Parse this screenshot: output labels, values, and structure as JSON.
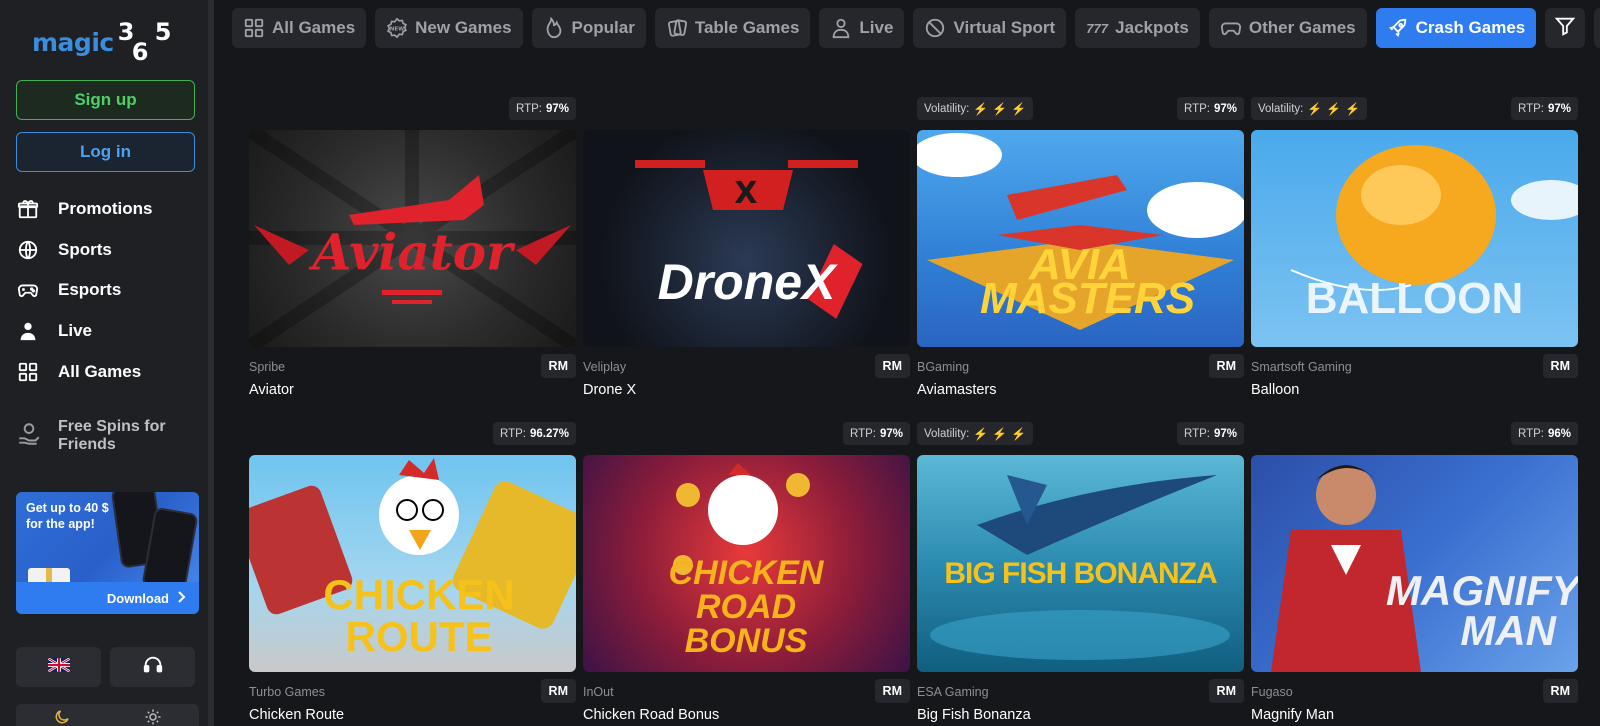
{
  "logo": {
    "word": "magic",
    "nums_top": "3 5",
    "nums_bottom": "6"
  },
  "auth": {
    "signup": "Sign up",
    "login": "Log in"
  },
  "nav": [
    {
      "label": "Promotions",
      "icon": "gift-icon"
    },
    {
      "label": "Sports",
      "icon": "ball-icon"
    },
    {
      "label": "Esports",
      "icon": "gamepad-icon"
    },
    {
      "label": "Live",
      "icon": "dealer-icon"
    },
    {
      "label": "All Games",
      "icon": "grid-icon"
    }
  ],
  "free_spins": {
    "line1": "Free Spins for",
    "line2": "Friends"
  },
  "promo": {
    "text": "Get up to 40 $ for the app!",
    "download": "Download"
  },
  "theme": {
    "dark": "moon-icon",
    "light": "sun-icon"
  },
  "tabs": [
    {
      "label": "All Games",
      "icon": "grid-icon",
      "active": false
    },
    {
      "label": "New Games",
      "icon": "new-badge-icon",
      "active": false
    },
    {
      "label": "Popular",
      "icon": "flame-icon",
      "active": false
    },
    {
      "label": "Table Games",
      "icon": "cards-icon",
      "active": false
    },
    {
      "label": "Live",
      "icon": "dealer-icon",
      "active": false
    },
    {
      "label": "Virtual Sport",
      "icon": "ball-icon",
      "active": false
    },
    {
      "label": "Jackpots",
      "icon": "777-icon",
      "active": false
    },
    {
      "label": "Other Games",
      "icon": "gamepad-icon",
      "active": false
    },
    {
      "label": "Crash Games",
      "icon": "rocket-icon",
      "active": true
    }
  ],
  "labels": {
    "rtp": "RTP:",
    "volatility": "Volatility:",
    "currency": "RM"
  },
  "games": [
    {
      "name": "Aviator",
      "provider": "Spribe",
      "rtp": "97%",
      "volatility": null,
      "art": "Aviator"
    },
    {
      "name": "Drone X",
      "provider": "Veliplay",
      "rtp": null,
      "volatility": null,
      "art": "DroneX"
    },
    {
      "name": "Aviamasters",
      "provider": "BGaming",
      "rtp": "97%",
      "volatility": 2,
      "art": "AVIA MASTERS"
    },
    {
      "name": "Balloon",
      "provider": "Smartsoft Gaming",
      "rtp": "97%",
      "volatility": 2,
      "art": "BALLOON"
    },
    {
      "name": "Chicken Route",
      "provider": "Turbo Games",
      "rtp": "96.27%",
      "volatility": null,
      "art": "CHICKEN ROUTE"
    },
    {
      "name": "Chicken Road Bonus",
      "provider": "InOut",
      "rtp": "97%",
      "volatility": null,
      "art": "CHICKEN ROAD BONUS"
    },
    {
      "name": "Big Fish Bonanza",
      "provider": "ESA Gaming",
      "rtp": "97%",
      "volatility": 2,
      "art": "BIG FISH BONANZA"
    },
    {
      "name": "Magnify Man",
      "provider": "Fugaso",
      "rtp": "96%",
      "volatility": null,
      "art": "MAGNIFY MAN"
    }
  ]
}
